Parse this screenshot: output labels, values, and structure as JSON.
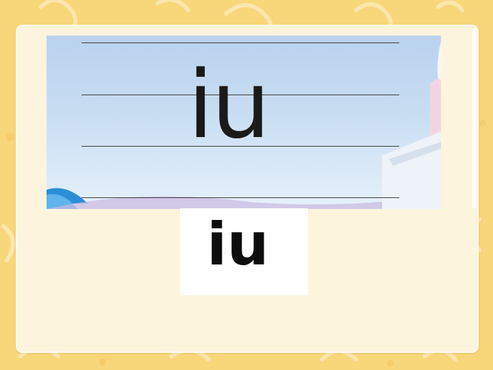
{
  "writing_board": {
    "text": "iu"
  },
  "answer_card": {
    "text": "iu"
  },
  "colors": {
    "background": "#f8d67a",
    "card": "#fcf4dd",
    "sky_top": "#b9d2ee",
    "sky_bottom": "#e6f1fb",
    "text": "#1a1a1a"
  }
}
